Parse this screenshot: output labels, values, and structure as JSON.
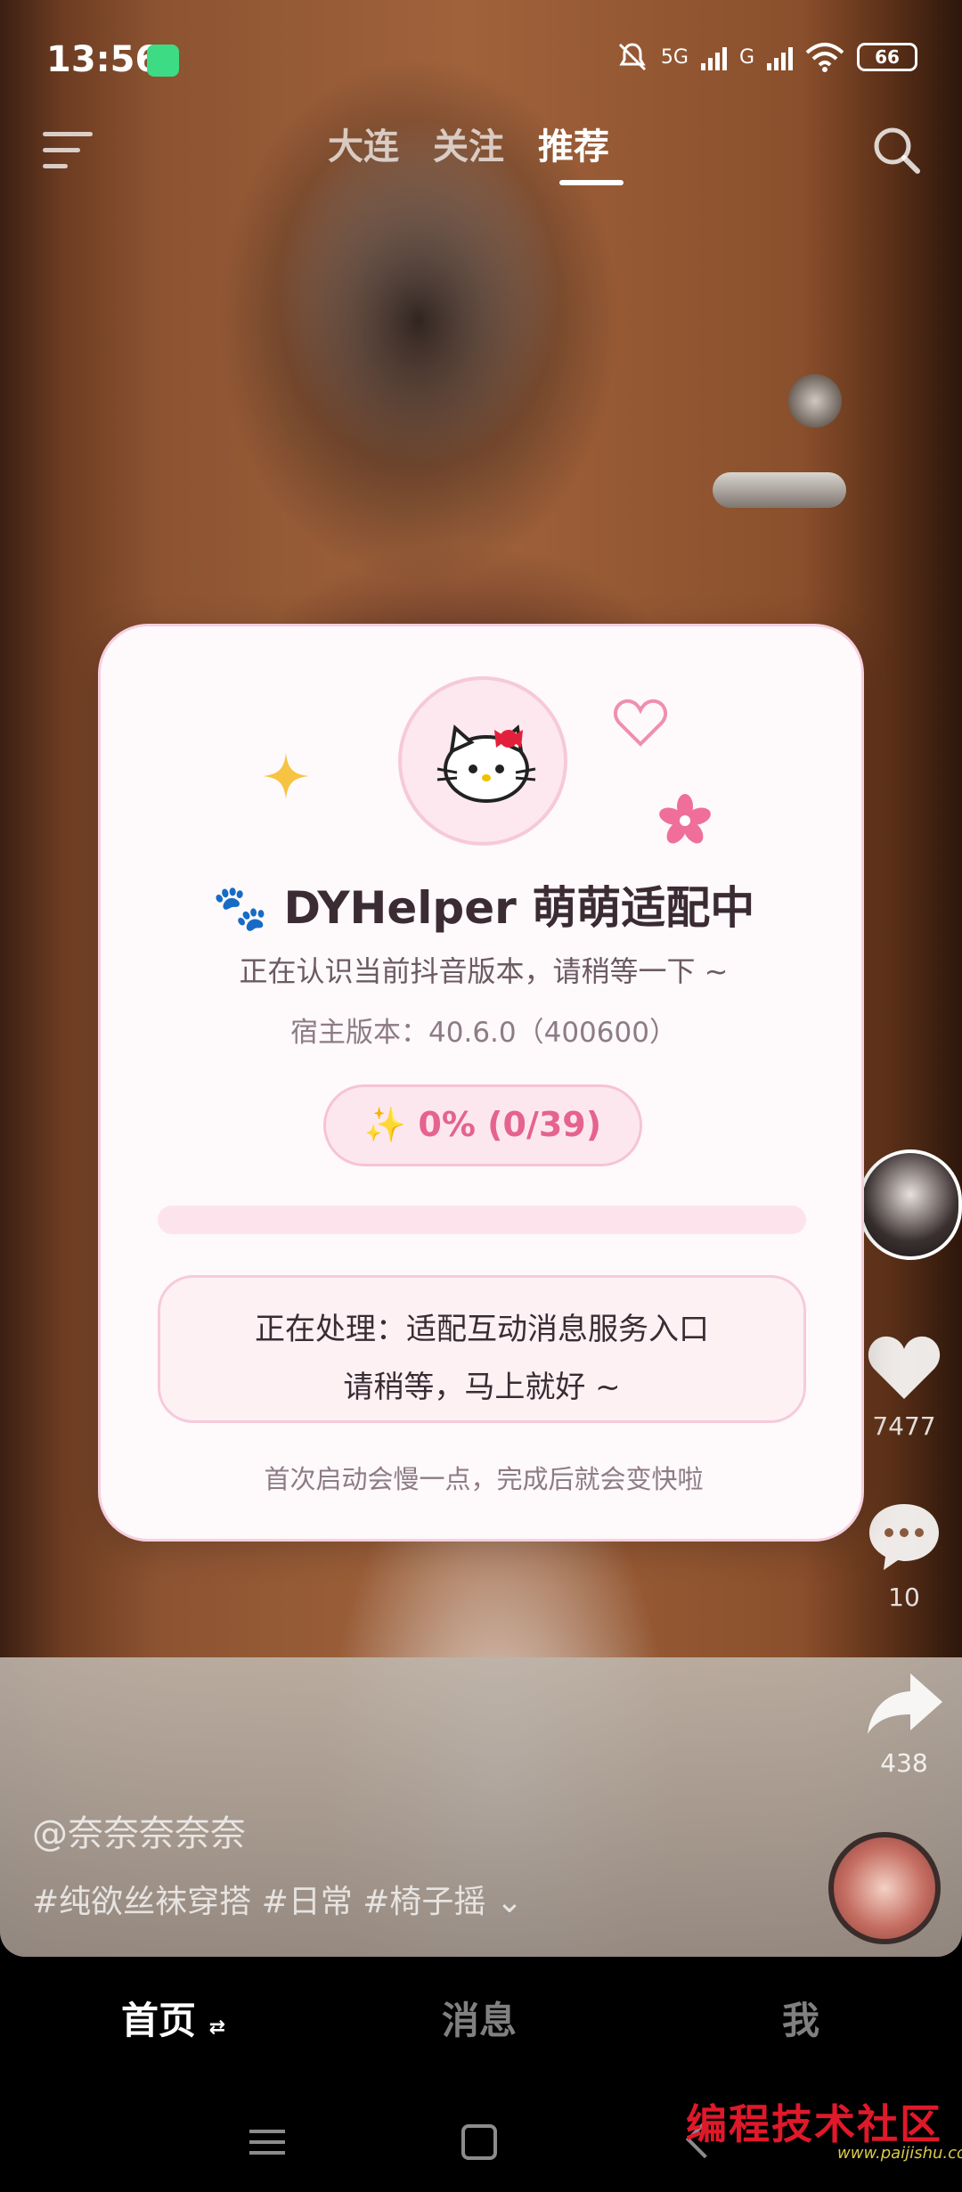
{
  "status_bar": {
    "time": "13:56",
    "network_5g": "5G",
    "network_g": "G",
    "battery": "66"
  },
  "top_nav": {
    "tabs": [
      {
        "label": "大连",
        "active": false
      },
      {
        "label": "关注",
        "active": false
      },
      {
        "label": "推荐",
        "active": true
      }
    ]
  },
  "actions": {
    "like_count": "7477",
    "comment_count": "10",
    "share_count": "438"
  },
  "caption": {
    "author": "@奈奈奈奈奈",
    "tags": "#纯欲丝袜穿搭 #日常 #椅子摇",
    "expand_glyph": "⌄"
  },
  "bottom_tabs": {
    "home": "首页",
    "home_switch_glyph": "⇄",
    "messages": "消息",
    "me": "我"
  },
  "dialog": {
    "title": "🐾 DYHelper 萌萌适配中",
    "subtitle": "正在认识当前抖音版本，请稍等一下 ~",
    "host_version": "宿主版本：40.6.0（400600）",
    "progress_label": "✨ 0% (0/39)",
    "progress_fraction": 0,
    "processing_line1": "正在处理：适配互动消息服务入口",
    "processing_line2": "请稍等，马上就好 ~",
    "footnote": "首次启动会慢一点，完成后就会变快啦",
    "accent_color": "#e5638e"
  },
  "watermark": {
    "text": "编程技术社区",
    "url": "www.paijishu.com"
  }
}
